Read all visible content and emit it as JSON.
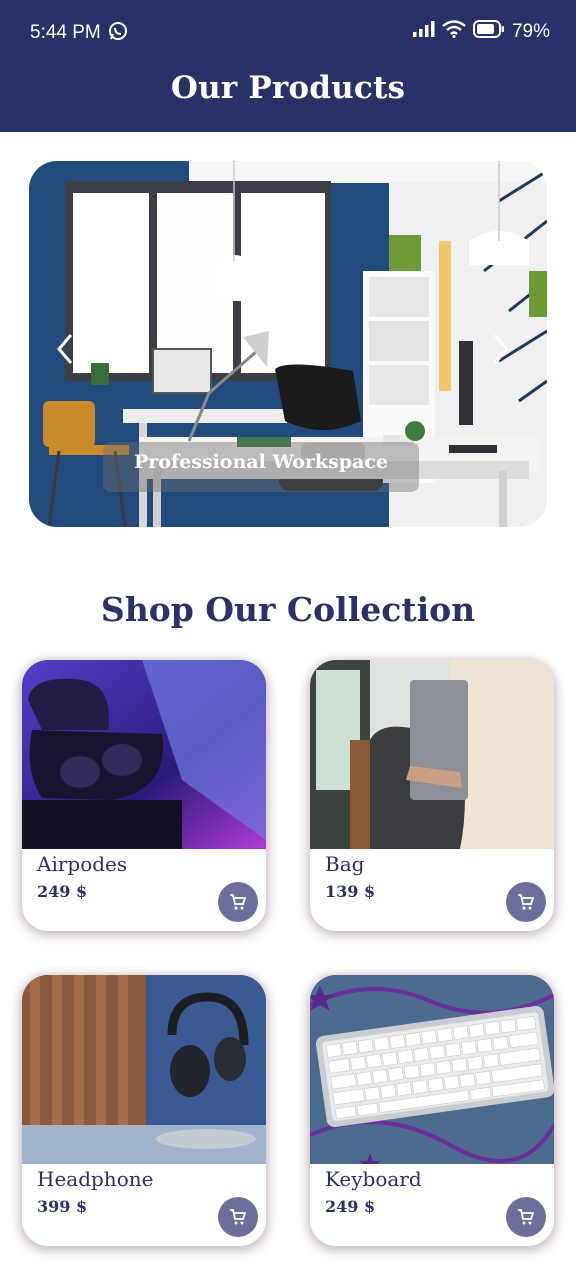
{
  "status_bar": {
    "time": "5:44 PM",
    "battery": "79%"
  },
  "header": {
    "title": "Our Products"
  },
  "carousel": {
    "caption": "Professional Workspace"
  },
  "collection": {
    "title": "Shop Our Collection",
    "products": [
      {
        "name": "Airpodes",
        "price": "249 $"
      },
      {
        "name": "Bag",
        "price": "139 $"
      },
      {
        "name": "Headphone",
        "price": "399 $"
      },
      {
        "name": "Keyboard",
        "price": "249 $"
      }
    ]
  },
  "icons": [
    "whatsapp-icon",
    "signal-icon",
    "wifi-icon",
    "battery-icon",
    "chevron-left-icon",
    "chevron-right-icon",
    "cart-icon"
  ],
  "colors": {
    "primary": "#2a3168",
    "cart_button": "#6d6f9b"
  }
}
